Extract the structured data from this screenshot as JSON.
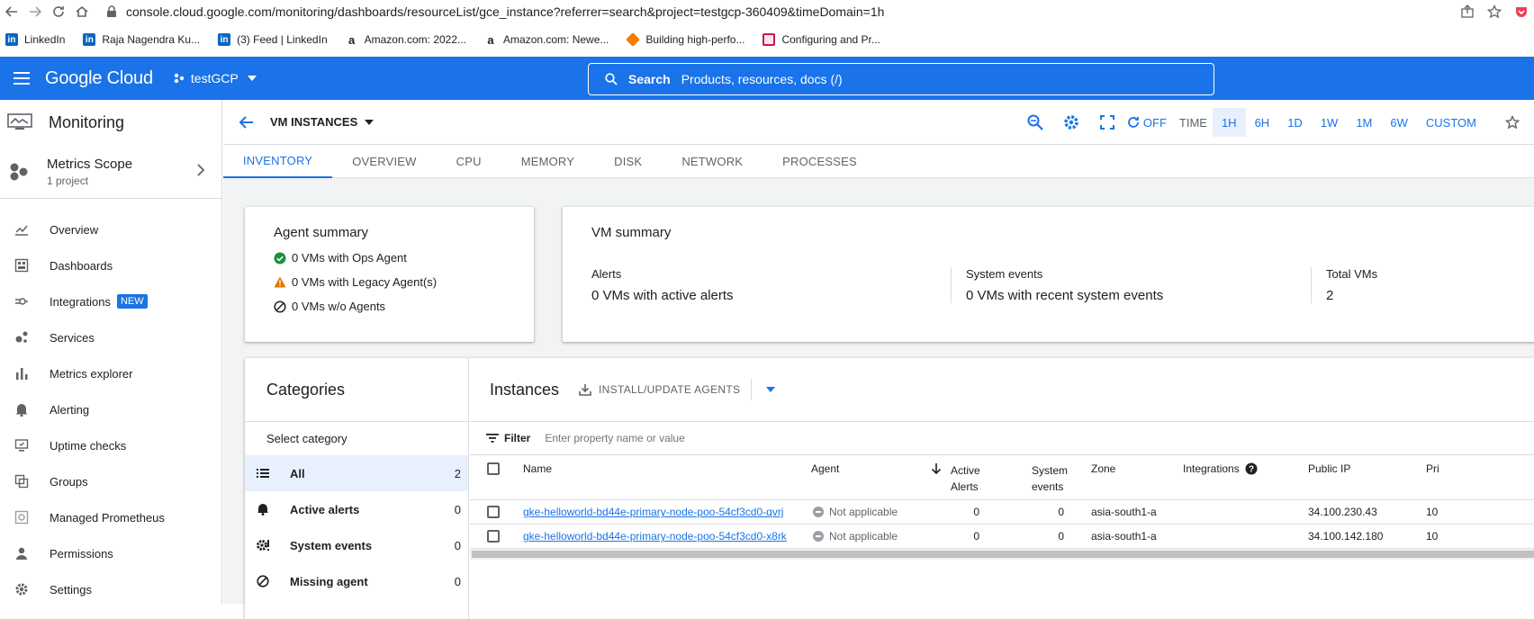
{
  "browser": {
    "url": "console.cloud.google.com/monitoring/dashboards/resourceList/gce_instance?referrer=search&project=testgcp-360409&timeDomain=1h",
    "bookmarks": [
      {
        "label": "LinkedIn",
        "color": "#0a66c2",
        "glyph": "in"
      },
      {
        "label": "Raja Nagendra Ku...",
        "color": "#0a66c2",
        "glyph": "in"
      },
      {
        "label": "(3) Feed | LinkedIn",
        "color": "#0a66c2",
        "glyph": "in"
      },
      {
        "label": "Amazon.com: 2022...",
        "color": "#222",
        "glyph": "a"
      },
      {
        "label": "Amazon.com: Newe...",
        "color": "#222",
        "glyph": "a"
      },
      {
        "label": "Building high-perfo...",
        "color": "#f57c00",
        "glyph": ""
      },
      {
        "label": "Configuring and Pr...",
        "color": "#c2185b",
        "glyph": ""
      }
    ]
  },
  "header": {
    "brand": "Google Cloud",
    "project": "testGCP",
    "search_label": "Search",
    "search_hint": "Products, resources, docs (/)",
    "accent": "#1a73e8"
  },
  "leftnav": {
    "title": "Monitoring",
    "scope_name": "Metrics Scope",
    "scope_sub": "1 project",
    "items": [
      {
        "label": "Overview",
        "icon": "chart-line-icon"
      },
      {
        "label": "Dashboards",
        "icon": "dashboard-icon"
      },
      {
        "label": "Integrations",
        "icon": "integrations-icon",
        "badge": "NEW"
      },
      {
        "label": "Services",
        "icon": "services-icon"
      },
      {
        "label": "Metrics explorer",
        "icon": "bar-chart-icon"
      },
      {
        "label": "Alerting",
        "icon": "bell-icon"
      },
      {
        "label": "Uptime checks",
        "icon": "monitor-icon"
      },
      {
        "label": "Groups",
        "icon": "groups-icon"
      },
      {
        "label": "Managed Prometheus",
        "icon": "prometheus-icon"
      },
      {
        "label": "Permissions",
        "icon": "person-icon"
      },
      {
        "label": "Settings",
        "icon": "gear-icon"
      }
    ]
  },
  "topbar": {
    "title": "VM INSTANCES",
    "refresh": "OFF",
    "time_label": "TIME",
    "ranges": [
      "1H",
      "6H",
      "1D",
      "1W",
      "1M",
      "6W",
      "CUSTOM"
    ],
    "active_range": "1H"
  },
  "tabs": [
    "INVENTORY",
    "OVERVIEW",
    "CPU",
    "MEMORY",
    "DISK",
    "NETWORK",
    "PROCESSES"
  ],
  "agent_summary": {
    "title": "Agent summary",
    "rows": [
      {
        "text": "0 VMs with Ops Agent",
        "icon": "check-circle-icon"
      },
      {
        "text": "0 VMs with Legacy Agent(s)",
        "icon": "warning-icon"
      },
      {
        "text": "0 VMs w/o Agents",
        "icon": "block-icon"
      }
    ]
  },
  "vm_summary": {
    "title": "VM summary",
    "cols": [
      {
        "label": "Alerts",
        "value": "0 VMs with active alerts"
      },
      {
        "label": "System events",
        "value": "0 VMs with recent system events"
      },
      {
        "label": "Total VMs",
        "value": "2"
      }
    ]
  },
  "categories": {
    "title": "Categories",
    "select_label": "Select category",
    "rows": [
      {
        "label": "All",
        "count": "2",
        "icon": "list-icon"
      },
      {
        "label": "Active alerts",
        "count": "0",
        "icon": "bell-icon"
      },
      {
        "label": "System events",
        "count": "0",
        "icon": "gear-alert-icon"
      },
      {
        "label": "Missing agent",
        "count": "0",
        "icon": "block-icon"
      }
    ]
  },
  "instances": {
    "title": "Instances",
    "install_label": "INSTALL/UPDATE AGENTS",
    "filter_label": "Filter",
    "filter_placeholder": "Enter property name or value",
    "columns": {
      "name": "Name",
      "agent": "Agent",
      "active_alerts_1": "Active",
      "active_alerts_2": "Alerts",
      "system_events_1": "System",
      "system_events_2": "events",
      "zone": "Zone",
      "integrations": "Integrations",
      "public_ip": "Public IP",
      "private": "Pri"
    },
    "rows": [
      {
        "name": "gke-helloworld-bd44e-primary-node-poo-54cf3cd0-qvrj",
        "agent": "Not applicable",
        "alerts": "0",
        "events": "0",
        "zone": "asia-south1-a",
        "ip": "34.100.230.43",
        "priv": "10"
      },
      {
        "name": "gke-helloworld-bd44e-primary-node-poo-54cf3cd0-x8rk",
        "agent": "Not applicable",
        "alerts": "0",
        "events": "0",
        "zone": "asia-south1-a",
        "ip": "34.100.142.180",
        "priv": "10"
      }
    ]
  }
}
